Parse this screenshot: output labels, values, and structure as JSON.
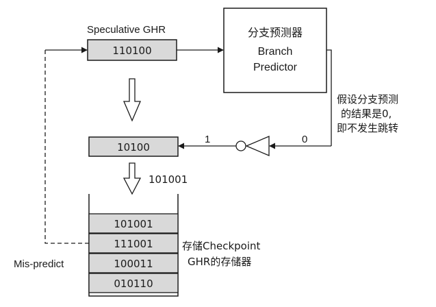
{
  "ghr": {
    "label": "Speculative GHR",
    "value": "110100",
    "shifted_value": "10100",
    "checkpoint_value": "101001"
  },
  "predictor": {
    "line1": "分支预测器",
    "line2": "Branch",
    "line3": "Predictor"
  },
  "assumption": {
    "line1": "假设分支预测",
    "line2": "的结果是0,",
    "line3": "即不发生跳转"
  },
  "bits": {
    "in": "0",
    "out": "1"
  },
  "checkpoint_stack": {
    "entries": [
      "101001",
      "111001",
      "100011",
      "010110"
    ],
    "label_line1": "存储Checkpoint",
    "label_line2": "GHR的存储器"
  },
  "mispredict_label": "Mis-predict",
  "colors": {
    "register_fill": "#d9d9d9",
    "line": "#1a1a1a",
    "background": "#ffffff"
  }
}
